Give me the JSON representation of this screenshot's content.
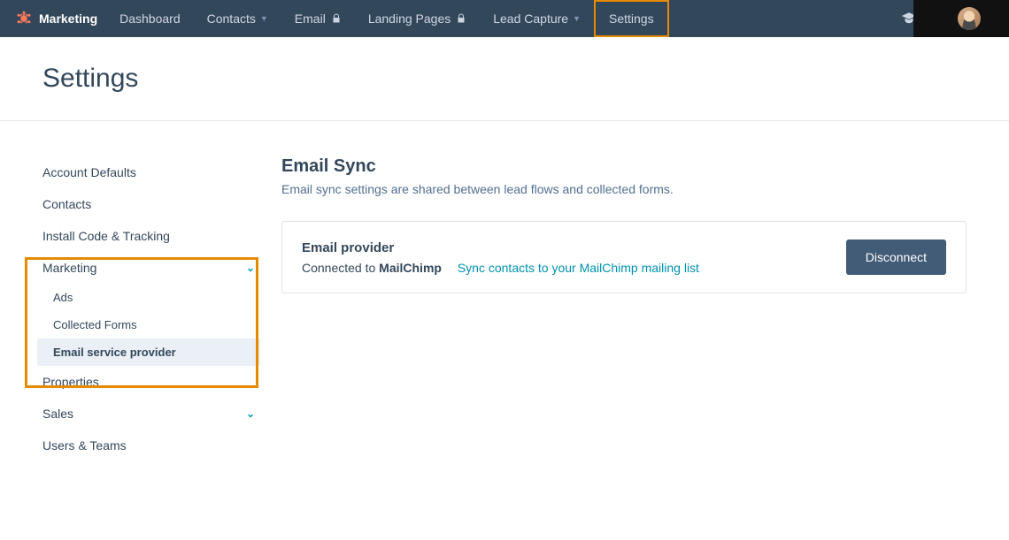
{
  "nav": {
    "brand": "Marketing",
    "items": [
      {
        "label": "Dashboard",
        "dropdown": false,
        "lock": false
      },
      {
        "label": "Contacts",
        "dropdown": true,
        "lock": false
      },
      {
        "label": "Email",
        "dropdown": false,
        "lock": true
      },
      {
        "label": "Landing Pages",
        "dropdown": false,
        "lock": true
      },
      {
        "label": "Lead Capture",
        "dropdown": true,
        "lock": false
      },
      {
        "label": "Settings",
        "dropdown": false,
        "lock": false,
        "highlighted": true
      }
    ]
  },
  "page": {
    "title": "Settings"
  },
  "sidebar": {
    "items": [
      {
        "label": "Account Defaults"
      },
      {
        "label": "Contacts"
      },
      {
        "label": "Install Code & Tracking"
      },
      {
        "label": "Marketing",
        "expandable": true,
        "expanded": true,
        "children": [
          {
            "label": "Ads"
          },
          {
            "label": "Collected Forms"
          },
          {
            "label": "Email service provider",
            "active": true
          }
        ]
      },
      {
        "label": "Properties"
      },
      {
        "label": "Sales",
        "expandable": true,
        "expanded": false
      },
      {
        "label": "Users & Teams"
      }
    ]
  },
  "content": {
    "title": "Email Sync",
    "subtitle": "Email sync settings are shared between lead flows and collected forms.",
    "card": {
      "title": "Email provider",
      "connected_prefix": "Connected to ",
      "provider": "MailChimp",
      "link": "Sync contacts to your MailChimp mailing list",
      "button": "Disconnect"
    }
  }
}
